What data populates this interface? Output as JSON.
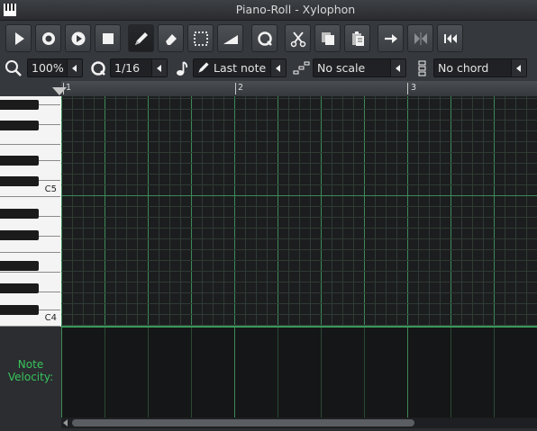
{
  "window": {
    "title": "Piano-Roll - Xylophon"
  },
  "toolbar": {
    "play": "play-icon",
    "record": "record-icon",
    "record_accompany": "record-while-playing-icon",
    "stop": "stop-icon",
    "draw": "pencil-icon",
    "erase": "eraser-icon",
    "select": "select-icon",
    "detune": "detune-icon",
    "quantize": "quantize-icon",
    "cut": "cut-icon",
    "copy": "copy-icon",
    "paste": "paste-icon",
    "jump": "arrow-right-icon",
    "flip": "flip-icon",
    "rewind": "rewind-icon"
  },
  "toolbar2": {
    "zoom": "100%",
    "quantize": "1/16",
    "note_length": "Last note",
    "scale": "No scale",
    "chord": "No chord"
  },
  "ruler": {
    "bars": [
      "1",
      "2",
      "3"
    ]
  },
  "keyboard": {
    "labels": [
      "C5",
      "C4"
    ]
  },
  "velocity": {
    "label_line1": "Note",
    "label_line2": "Velocity:"
  },
  "colors": {
    "grid_line": "#2f3b33",
    "beat_line": "#3c8a58",
    "accent_green": "#38c45c"
  }
}
